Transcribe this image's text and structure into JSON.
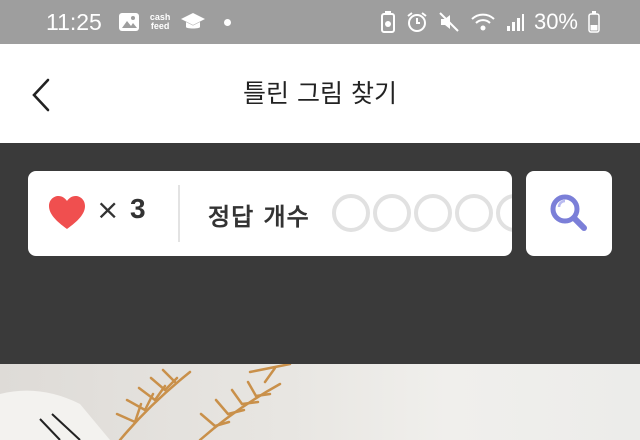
{
  "status_bar": {
    "time": "11:25",
    "cash_icon_text": [
      "cash",
      "feed"
    ],
    "battery": "30%"
  },
  "header": {
    "title": "틀린 그림 찾기",
    "back_icon": "chevron-left-icon"
  },
  "score": {
    "lives_label": "×",
    "lives": "3",
    "answers_label": "정답 개수",
    "answers_found": 0,
    "answers_total": 5
  },
  "hint_button_icon": "search-icon",
  "colors": {
    "statusbar": "#9e9e9e",
    "panel": "#3a3a3a",
    "heart": "#f04f4f",
    "search_icon": "#7b7fd8",
    "circle_empty": "#e1e1e1"
  }
}
